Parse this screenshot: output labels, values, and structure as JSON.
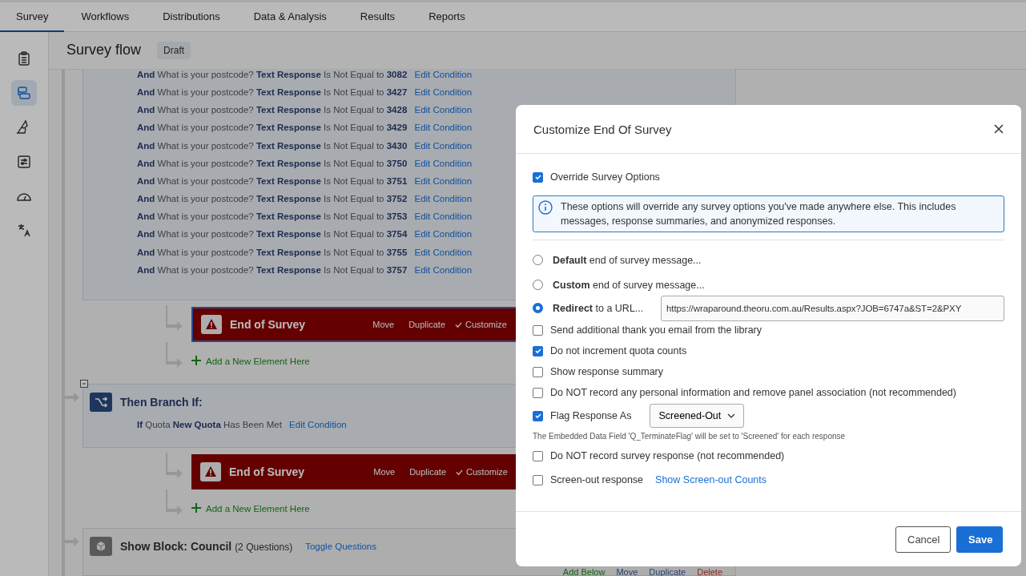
{
  "tabs": [
    {
      "label": "Survey",
      "selected": true
    },
    {
      "label": "Workflows",
      "selected": false
    },
    {
      "label": "Distributions",
      "selected": false
    },
    {
      "label": "Data & Analysis",
      "selected": false
    },
    {
      "label": "Results",
      "selected": false
    },
    {
      "label": "Reports",
      "selected": false
    }
  ],
  "rail": [
    {
      "kind": "clipboard",
      "selected": false
    },
    {
      "kind": "flow",
      "selected": true
    },
    {
      "kind": "brush",
      "selected": false
    },
    {
      "kind": "sliders",
      "selected": false
    },
    {
      "kind": "gauge",
      "selected": false
    },
    {
      "kind": "translate",
      "selected": false
    }
  ],
  "header": {
    "title": "Survey flow",
    "status": "Draft"
  },
  "flow": [
    {
      "kind": "conditions",
      "conditions": [
        {
          "connector": "And",
          "question": "What is your postcode?",
          "field": "Text Response",
          "operator": "Is Not Equal to",
          "value": "3082",
          "link": "Edit Condition"
        },
        {
          "connector": "And",
          "question": "What is your postcode?",
          "field": "Text Response",
          "operator": "Is Not Equal to",
          "value": "3427",
          "link": "Edit Condition"
        },
        {
          "connector": "And",
          "question": "What is your postcode?",
          "field": "Text Response",
          "operator": "Is Not Equal to",
          "value": "3428",
          "link": "Edit Condition"
        },
        {
          "connector": "And",
          "question": "What is your postcode?",
          "field": "Text Response",
          "operator": "Is Not Equal to",
          "value": "3429",
          "link": "Edit Condition"
        },
        {
          "connector": "And",
          "question": "What is your postcode?",
          "field": "Text Response",
          "operator": "Is Not Equal to",
          "value": "3430",
          "link": "Edit Condition"
        },
        {
          "connector": "And",
          "question": "What is your postcode?",
          "field": "Text Response",
          "operator": "Is Not Equal to",
          "value": "3750",
          "link": "Edit Condition"
        },
        {
          "connector": "And",
          "question": "What is your postcode?",
          "field": "Text Response",
          "operator": "Is Not Equal to",
          "value": "3751",
          "link": "Edit Condition"
        },
        {
          "connector": "And",
          "question": "What is your postcode?",
          "field": "Text Response",
          "operator": "Is Not Equal to",
          "value": "3752",
          "link": "Edit Condition"
        },
        {
          "connector": "And",
          "question": "What is your postcode?",
          "field": "Text Response",
          "operator": "Is Not Equal to",
          "value": "3753",
          "link": "Edit Condition"
        },
        {
          "connector": "And",
          "question": "What is your postcode?",
          "field": "Text Response",
          "operator": "Is Not Equal to",
          "value": "3754",
          "link": "Edit Condition"
        },
        {
          "connector": "And",
          "question": "What is your postcode?",
          "field": "Text Response",
          "operator": "Is Not Equal to",
          "value": "3755",
          "link": "Edit Condition"
        },
        {
          "connector": "And",
          "question": "What is your postcode?",
          "field": "Text Response",
          "operator": "Is Not Equal to",
          "value": "3757",
          "link": "Edit Condition"
        }
      ],
      "children": [
        {
          "kind": "end",
          "title": "End of Survey",
          "selected": true,
          "actions": [
            "Move",
            "Duplicate",
            "Customize"
          ]
        },
        {
          "kind": "add",
          "label": "Add a New Element Here"
        }
      ]
    },
    {
      "kind": "branch",
      "title": "Then Branch If:",
      "condition": {
        "connector": "If",
        "subject": "Quota",
        "name": "New Quota",
        "state": "Has Been Met",
        "link": "Edit Condition"
      },
      "children": [
        {
          "kind": "end",
          "title": "End of Survey",
          "selected": false,
          "actions": [
            "Move",
            "Duplicate",
            "Customize"
          ]
        },
        {
          "kind": "add",
          "label": "Add a New Element Here"
        }
      ]
    },
    {
      "kind": "block",
      "title": "Show Block: Council",
      "count": "(2 Questions)",
      "link": "Toggle Questions",
      "actions": [
        "Add Below",
        "Move",
        "Duplicate",
        "Delete"
      ]
    }
  ],
  "modal": {
    "title": "Customize End Of Survey",
    "override": {
      "label": "Override Survey Options",
      "checked": true
    },
    "info": "These options will override any survey options you've made anywhere else. This includes messages, response summaries, and anonymized responses.",
    "radios": [
      {
        "strong": "Default",
        "rest": "end of survey message...",
        "selected": false
      },
      {
        "strong": "Custom",
        "rest": "end of survey message...",
        "selected": false
      },
      {
        "strong": "Redirect",
        "rest": "to a URL...",
        "selected": true,
        "url": "https://wraparound.theoru.com.au/Results.aspx?JOB=6747a&ST=2&PXY"
      }
    ],
    "options": [
      {
        "kind": "check",
        "label": "Send additional thank you email from the library",
        "checked": false
      },
      {
        "kind": "check",
        "label": "Do not increment quota counts",
        "checked": true
      },
      {
        "kind": "check",
        "label": "Show response summary",
        "checked": false
      },
      {
        "kind": "check",
        "label": "Do NOT record any personal information and remove panel association (not recommended)",
        "checked": false
      },
      {
        "kind": "select",
        "label": "Flag Response As",
        "checked": true,
        "value": "Screened-Out",
        "note": "The Embedded Data Field 'Q_TerminateFlag' will be set to 'Screened' for each response"
      },
      {
        "kind": "check",
        "label": "Do NOT record survey response (not recommended)",
        "checked": false
      },
      {
        "kind": "link",
        "label": "Screen-out response",
        "checked": false,
        "link": "Show Screen-out Counts"
      }
    ],
    "buttons": [
      {
        "label": "Cancel",
        "kind": "secondary"
      },
      {
        "label": "Save",
        "kind": "primary"
      }
    ]
  }
}
